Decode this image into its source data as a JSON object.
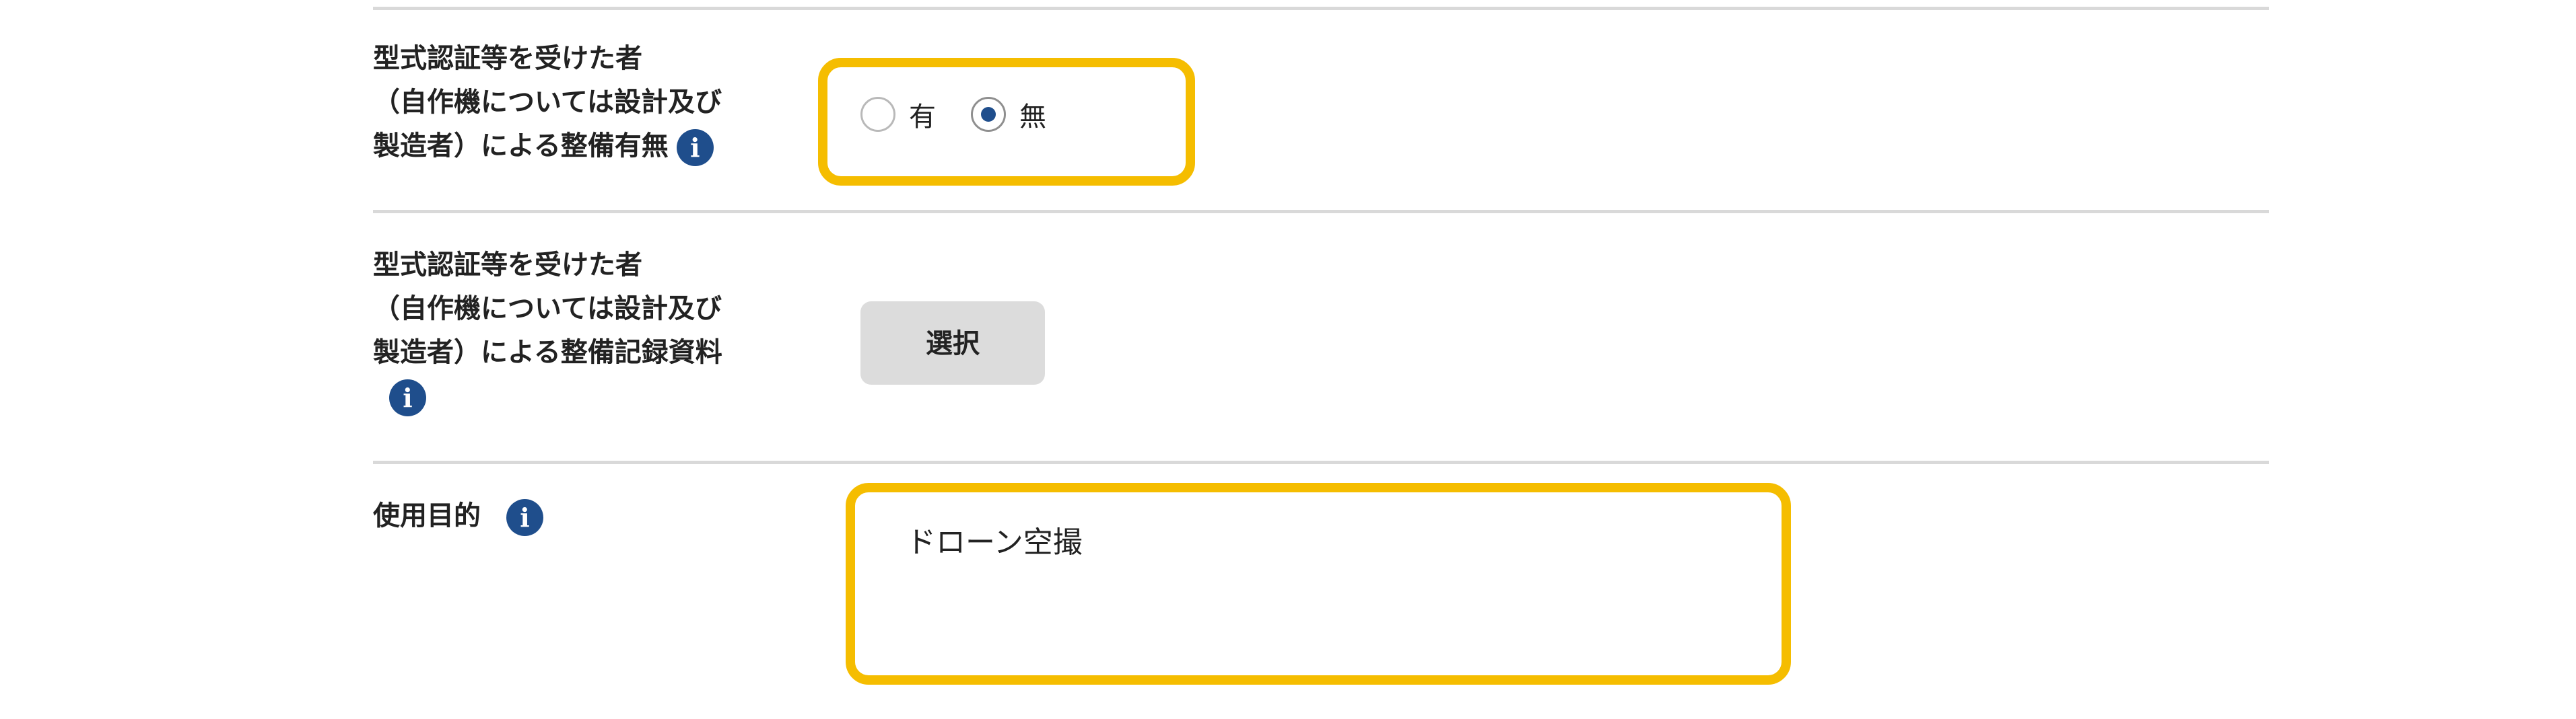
{
  "rows": {
    "maintenance_presence": {
      "label_lines": [
        "型式認証等を受けた者",
        "（自作機については設計及び",
        "製造者）による整備有無"
      ],
      "options": [
        {
          "label": "有",
          "checked": false
        },
        {
          "label": "無",
          "checked": true
        }
      ]
    },
    "maintenance_record": {
      "label_lines": [
        "型式認証等を受けた者",
        "（自作機については設計及び",
        "製造者）による整備記録資料"
      ],
      "button_label": "選択"
    },
    "purpose": {
      "label": "使用目的",
      "value": "ドローン空撮"
    }
  },
  "icons": {
    "info": "info-icon",
    "info_glyph": "i"
  },
  "colors": {
    "highlight": "#f5bd00",
    "accent": "#1f4e8c",
    "divider": "#d9d9d9",
    "button_bg": "#dcdcdc"
  }
}
